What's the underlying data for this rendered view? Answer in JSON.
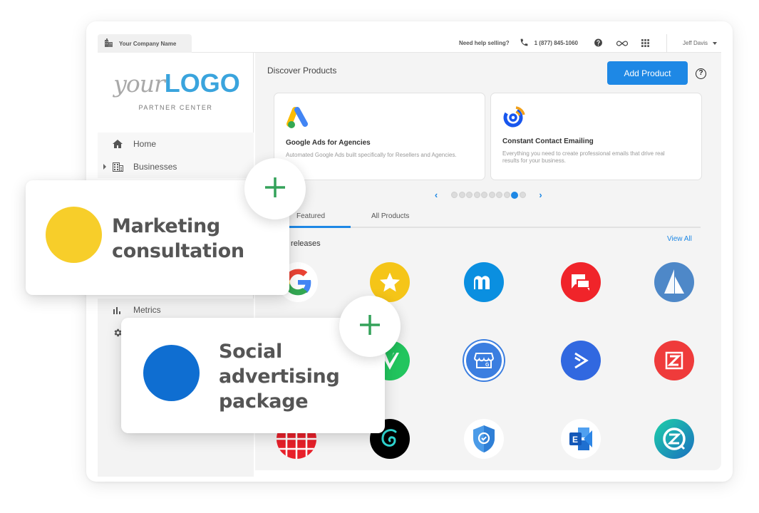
{
  "topbar": {
    "company_name": "Your Company Name",
    "help_text": "Need help selling?",
    "phone": "1 (877) 845-1060",
    "user_name": "Jeff Davis"
  },
  "sidebar": {
    "logo_your": "your",
    "logo_word": "LOGO",
    "subtitle": "PARTNER CENTER",
    "items": [
      {
        "label": "Home",
        "icon": "home-icon"
      },
      {
        "label": "Businesses",
        "icon": "building-icon"
      },
      {
        "label": "Metrics",
        "icon": "bar-chart-icon"
      },
      {
        "label": "",
        "icon": "gear-icon"
      }
    ]
  },
  "main": {
    "title": "Discover Products",
    "add_product_label": "Add Product",
    "help_icon": "?",
    "featured_cards": [
      {
        "title": "Google Ads for Agencies",
        "description": "Automated Google Ads built specifically for Resellers and Agencies.",
        "icon": "google-ads-icon"
      },
      {
        "title": "Constant Contact Emailing",
        "description": "Everything you need to create professional emails that drive real results for your business.",
        "icon": "constant-contact-icon"
      }
    ],
    "carousel": {
      "total_pages": 10,
      "active_page": 9
    },
    "tabs": [
      {
        "label": "Featured",
        "active": true
      },
      {
        "label": "All Products",
        "active": false
      }
    ],
    "section_title": "New releases",
    "view_all_label": "View All",
    "apps": [
      {
        "name": "google-icon",
        "color": "#ffffff"
      },
      {
        "name": "star-review-icon",
        "color": "#f5c518"
      },
      {
        "name": "m-brand-icon",
        "color": "#0a8fe0"
      },
      {
        "name": "chat-bubbles-icon",
        "color": "#f0242a"
      },
      {
        "name": "sail-icon",
        "color": "#4e88c8"
      },
      {
        "name": "v-check-icon",
        "color": "#22c55e"
      },
      {
        "name": "google-business-store-icon",
        "color": "#3b7ee0"
      },
      {
        "name": "activecampaign-arrow-icon",
        "color": "#3168e0"
      },
      {
        "name": "z-square-icon",
        "color": "#ef3b3b"
      },
      {
        "name": "globe-grid-icon",
        "color": "#e8202a"
      },
      {
        "name": "godaddy-swirl-icon",
        "color": "#000000"
      },
      {
        "name": "shield-check-icon",
        "color": "#3b8de0"
      },
      {
        "name": "exchange-icon",
        "color": "#1f6fd0"
      },
      {
        "name": "z-chat-icon",
        "color": "#1ab39a"
      }
    ]
  },
  "overlays": [
    {
      "label_lines": [
        "Marketing",
        "consultation"
      ],
      "dot_color": "#f7ce2a",
      "action": "+"
    },
    {
      "label_lines": [
        "Social",
        "advertising",
        "package"
      ],
      "dot_color": "#0f6ed1",
      "action": "+"
    }
  ],
  "colors": {
    "accent": "#1e88e5",
    "plus_green": "#34a25a",
    "logo_blue": "#3aa4dd"
  }
}
